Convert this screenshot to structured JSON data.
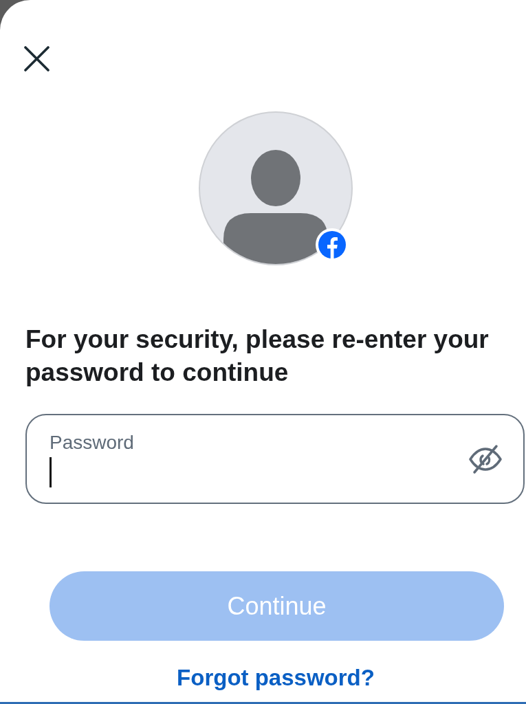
{
  "heading": "For your security, please re-enter your password to continue",
  "password_field": {
    "label": "Password",
    "focused": true,
    "value_visible": false
  },
  "continue_button": {
    "label": "Continue",
    "disabled": true
  },
  "forgot_link": {
    "label": "Forgot password?"
  }
}
